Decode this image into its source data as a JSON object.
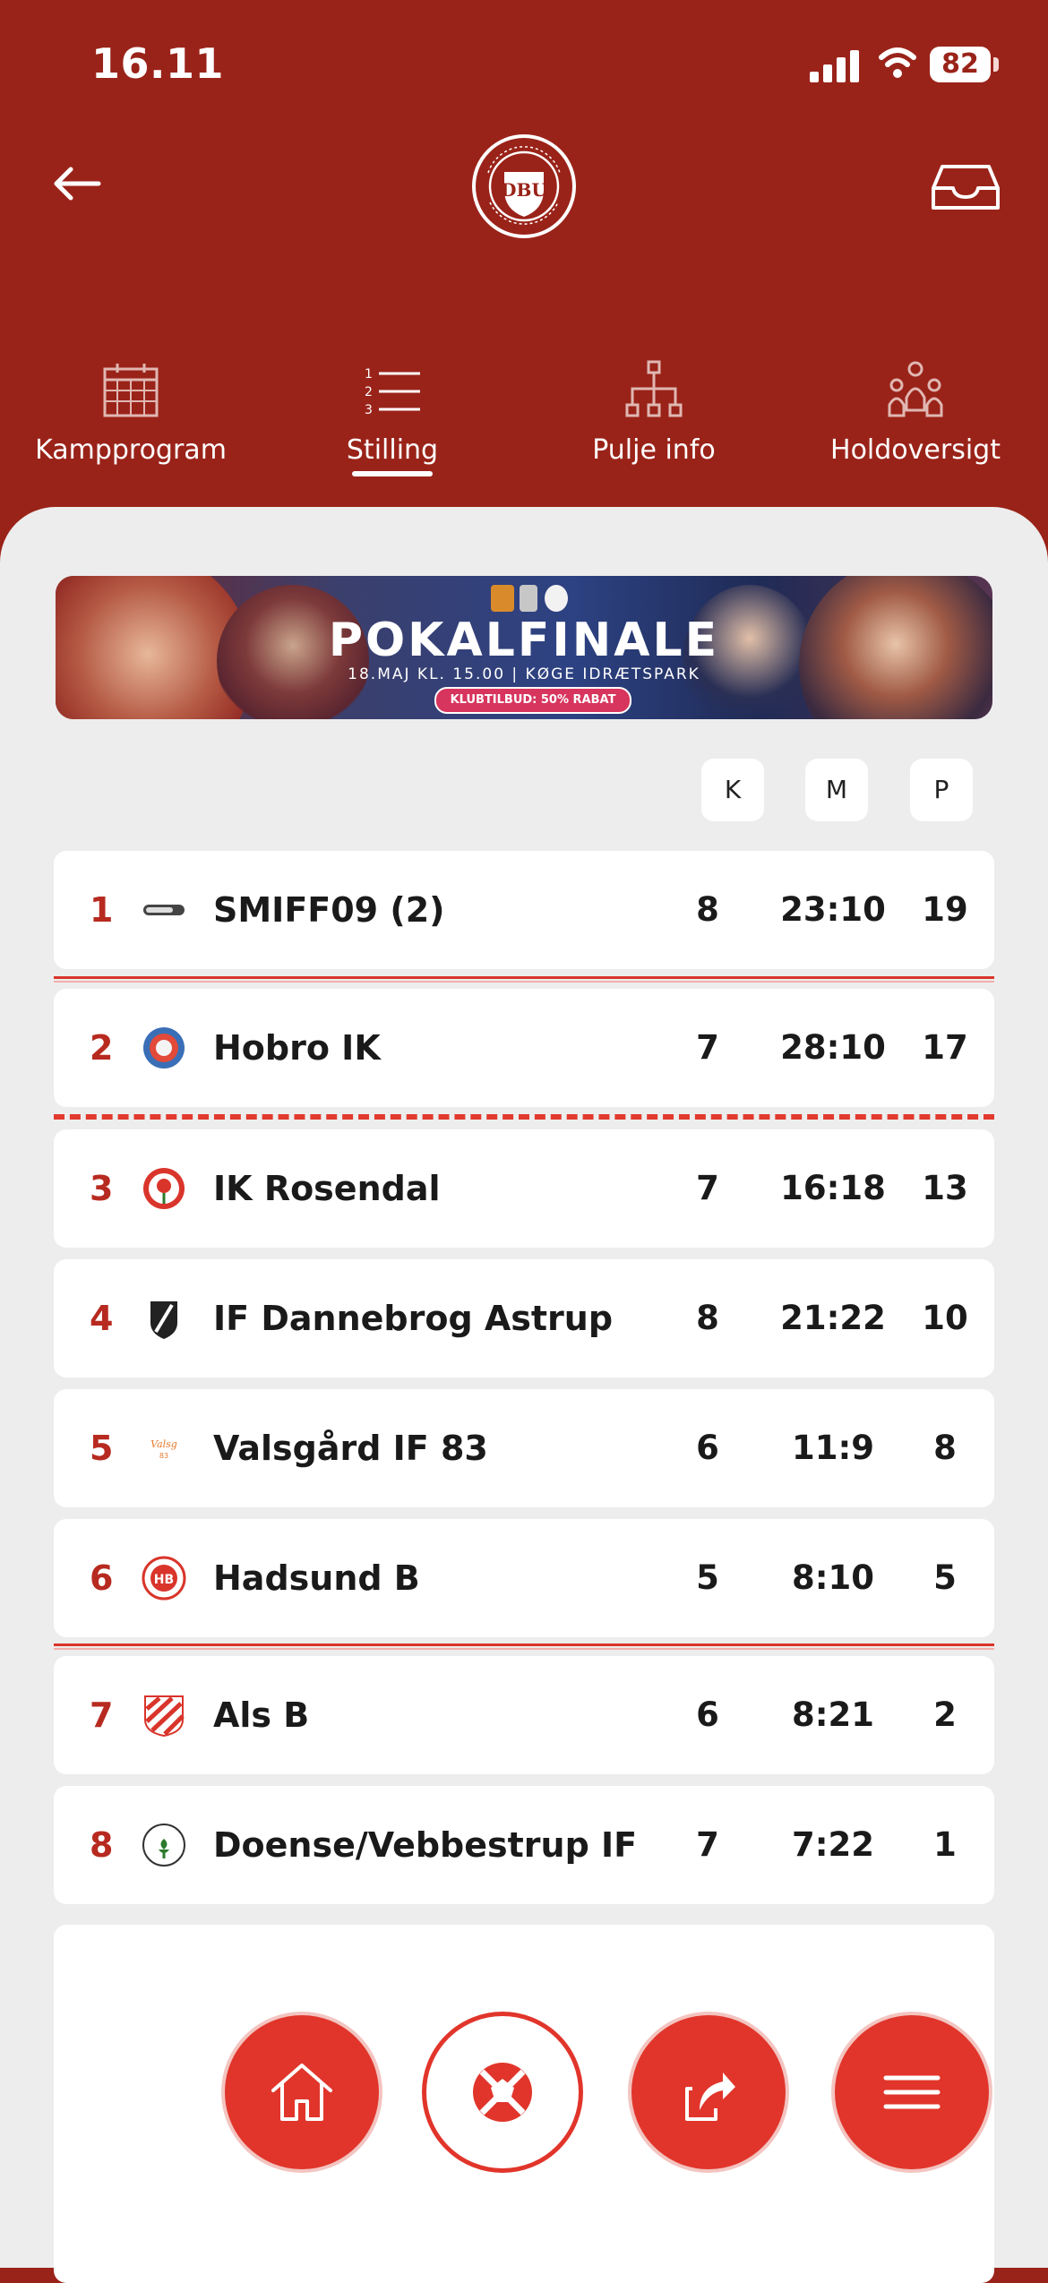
{
  "status_bar": {
    "time": "16.11",
    "battery": "82"
  },
  "header": {
    "logo_alt": "DBU"
  },
  "tabs": [
    {
      "label": "Kampprogram",
      "icon": "calendar-icon"
    },
    {
      "label": "Stilling",
      "icon": "ranked-list-icon",
      "active": true
    },
    {
      "label": "Pulje info",
      "icon": "hierarchy-icon"
    },
    {
      "label": "Holdoversigt",
      "icon": "teams-icon"
    }
  ],
  "banner": {
    "title": "POKALFINALE",
    "subtitle": "18.MAJ KL. 15.00 | KØGE IDRÆTSPARK",
    "offer": "KLUBTILBUD: 50% RABAT"
  },
  "table": {
    "columns": {
      "k": "K",
      "m": "M",
      "p": "P"
    },
    "rows": [
      {
        "pos": "1",
        "team": "SMIFF09 (2)",
        "k": "8",
        "m": "23:10",
        "p": "19"
      },
      {
        "pos": "2",
        "team": "Hobro IK",
        "k": "7",
        "m": "28:10",
        "p": "17"
      },
      {
        "pos": "3",
        "team": "IK Rosendal",
        "k": "7",
        "m": "16:18",
        "p": "13"
      },
      {
        "pos": "4",
        "team": "IF Dannebrog Astrup",
        "k": "8",
        "m": "21:22",
        "p": "10"
      },
      {
        "pos": "5",
        "team": "Valsgård IF 83",
        "k": "6",
        "m": "11:9",
        "p": "8"
      },
      {
        "pos": "6",
        "team": "Hadsund B",
        "k": "5",
        "m": "8:10",
        "p": "5"
      },
      {
        "pos": "7",
        "team": "Als B",
        "k": "6",
        "m": "8:21",
        "p": "2"
      },
      {
        "pos": "8",
        "team": "Doense/Vebbestrup IF",
        "k": "7",
        "m": "7:22",
        "p": "1"
      }
    ]
  },
  "fab": [
    {
      "name": "home-button",
      "icon": "home-icon"
    },
    {
      "name": "ball-button",
      "icon": "whistle-ball-icon"
    },
    {
      "name": "share-button",
      "icon": "share-icon"
    },
    {
      "name": "menu-button",
      "icon": "hamburger-icon"
    }
  ],
  "colors": {
    "brand_red": "#9a2319",
    "accent_red": "#e1352b",
    "position_red": "#b72a20",
    "background": "#ededed"
  }
}
